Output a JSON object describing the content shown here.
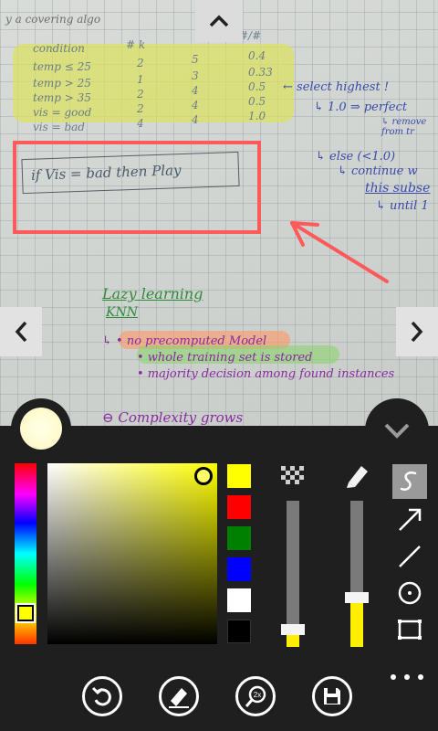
{
  "photo": {
    "title_ink": "y a covering algo",
    "table_header": [
      "condition",
      "# k",
      "#",
      "#/#"
    ],
    "table_rows": [
      [
        "temp ≤ 25",
        "2",
        "5",
        "0.4"
      ],
      [
        "temp > 25",
        "1",
        "3",
        "0.33"
      ],
      [
        "temp > 35",
        "2",
        "4",
        "0.5"
      ],
      [
        "vis = good",
        "2",
        "4",
        "0.5"
      ],
      [
        "vis = bad",
        "4",
        "4",
        "1.0"
      ]
    ],
    "select_note": "← select highest !",
    "perfect_note": "↳ 1.0 ⇒ perfect",
    "remove_note": "↳ remove\nfrom tr",
    "else_note": "↳ else (<1.0)",
    "continue_note": "↳ continue w",
    "subset_note": "this subse",
    "until_note": "↳ until 1",
    "rule_text": "if  Vis = bad   then   Play",
    "lazy_title": "Lazy learning",
    "knn": "KNN",
    "bullet1": "↳ • no precomputed Model",
    "bullet2": "• whole training set is stored",
    "bullet3": "• majority decision among found instances",
    "minus_note": "⊖ Complexity grows"
  },
  "current_color": "#fffbd0",
  "hue_value": "yellow",
  "swatches": [
    "#ffff00",
    "#ff0000",
    "#008000",
    "#0000ff",
    "#ffffff",
    "#000000"
  ],
  "opacity_level": 0.1,
  "stroke_level": 0.4,
  "tools": [
    "freehand-tool",
    "arrow-tool",
    "line-tool",
    "ellipse-tool",
    "rectangle-tool"
  ],
  "selected_tool": "freehand-tool",
  "bottom_actions": [
    "undo",
    "pen-settings",
    "zoom",
    "save"
  ],
  "zoom_label": "2x"
}
